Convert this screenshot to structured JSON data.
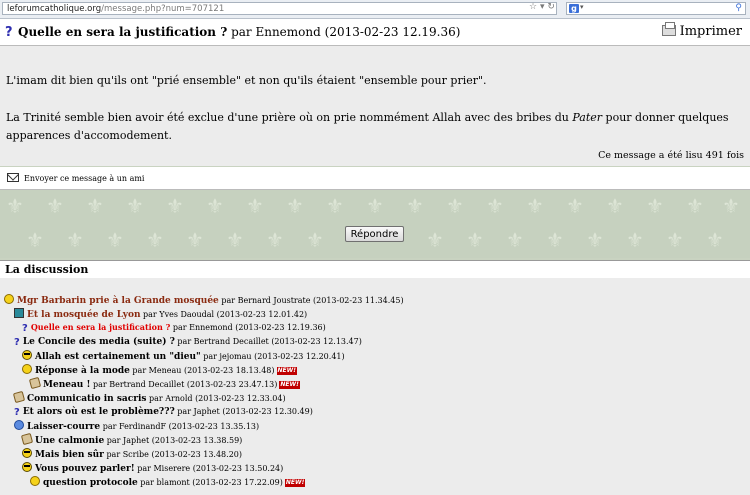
{
  "browser": {
    "url_domain": "leforumcatholique.org",
    "url_path": "/message.php?num=707121",
    "search_engine_letter": "g"
  },
  "message": {
    "title": "Quelle en sera la justification ?",
    "by": "par",
    "author": "Ennemond",
    "date": "(2013-02-23 12.19.36)",
    "print_label": "Imprimer",
    "para1": "L'imam dit bien qu'ils ont \"prié ensemble\" et non qu'ils étaient \"ensemble pour prier\".",
    "para2_before": "La Trinité semble bien avoir été exclue d'une prière où on prie nommément Allah avec des bribes du ",
    "para2_italic": "Pater",
    "para2_after": " pour donner quelques apparences d'accomodement.",
    "read_count_prefix": "Ce message a été lisu",
    "read_count": "491",
    "read_count_suffix": "fois"
  },
  "send_friend_label": "Envoyer ce message à un ami",
  "reply_button": "Répondre",
  "discussion": {
    "heading": "La discussion",
    "new_badge": "NEW!",
    "items": [
      {
        "title": "Mgr Barbarin prie à la Grande mosquée",
        "by": "par Bernard Joustrate",
        "date": "(2013-02-23 11.34.45)",
        "icon": "smiley-icon"
      },
      {
        "title": "Et la mosquée de Lyon",
        "by": "par Yves Daoudal",
        "date": "(2013-02-23 12.01.42)",
        "icon": "tv-icon"
      },
      {
        "title": "Quelle en sera la justification ?",
        "by": "par Ennemond",
        "date": "(2013-02-23 12.19.36)",
        "icon": "question-icon"
      },
      {
        "title": "Le Concile des media (suite) ?",
        "by": "par Bertrand Decaillet",
        "date": "(2013-02-23 12.13.47)",
        "icon": "question-icon"
      },
      {
        "title": "Allah est certainement un \"dieu\"",
        "by": "par jejomau",
        "date": "(2013-02-23 12.20.41)",
        "icon": "cool-icon"
      },
      {
        "title": "Réponse à la mode",
        "by": "par Meneau",
        "date": "(2013-02-23 18.13.48)",
        "icon": "smiley-icon"
      },
      {
        "title": "Meneau !",
        "by": "par Bertrand Decaillet",
        "date": "(2013-02-23 23.47.13)",
        "icon": "scroll-icon"
      },
      {
        "title": "Communicatio in sacris",
        "by": "par Arnold",
        "date": "(2013-02-23 12.33.04)",
        "icon": "scroll-icon"
      },
      {
        "title": "Et alors où est le problème???",
        "by": "par Japhet",
        "date": "(2013-02-23 12.30.49)",
        "icon": "question-icon"
      },
      {
        "title": "Laisser-courre",
        "by": "par FerdinandF",
        "date": "(2013-02-23 13.35.13)",
        "icon": "blue-face-icon"
      },
      {
        "title": "Une calmonie",
        "by": "par Japhet",
        "date": "(2013-02-23 13.38.59)",
        "icon": "scroll-icon"
      },
      {
        "title": "Mais bien sûr",
        "by": "par Scribe",
        "date": "(2013-02-23 13.48.20)",
        "icon": "cool-icon"
      },
      {
        "title": "Vous pouvez parler!",
        "by": "par Miserere",
        "date": "(2013-02-23 13.50.24)",
        "icon": "cool-icon"
      },
      {
        "title": "question protocole",
        "by": "par blamont",
        "date": "(2013-02-23 17.22.09)",
        "icon": "smiley-icon"
      }
    ]
  }
}
